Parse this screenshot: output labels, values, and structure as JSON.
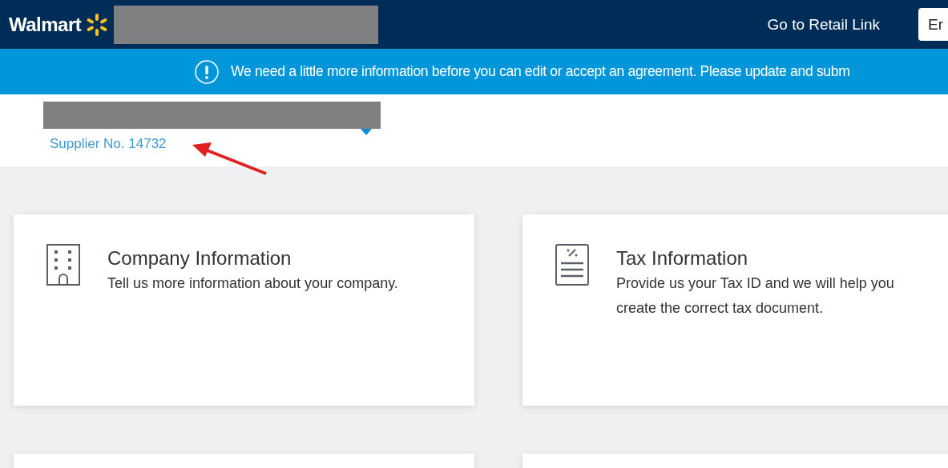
{
  "header": {
    "logo": "Walmart",
    "link": "Go to Retail Link",
    "button": "Er"
  },
  "banner": {
    "message": "We need a little more information before you can edit or accept an agreement. Please update and subm"
  },
  "supplier": {
    "number": "Supplier No. 14732"
  },
  "cards": [
    {
      "kind": "company",
      "title": "Company Information",
      "description": "Tell us more information about your company."
    },
    {
      "kind": "tax",
      "title": "Tax Information",
      "description": "Provide us your Tax ID and we will help you create the correct tax document."
    }
  ]
}
